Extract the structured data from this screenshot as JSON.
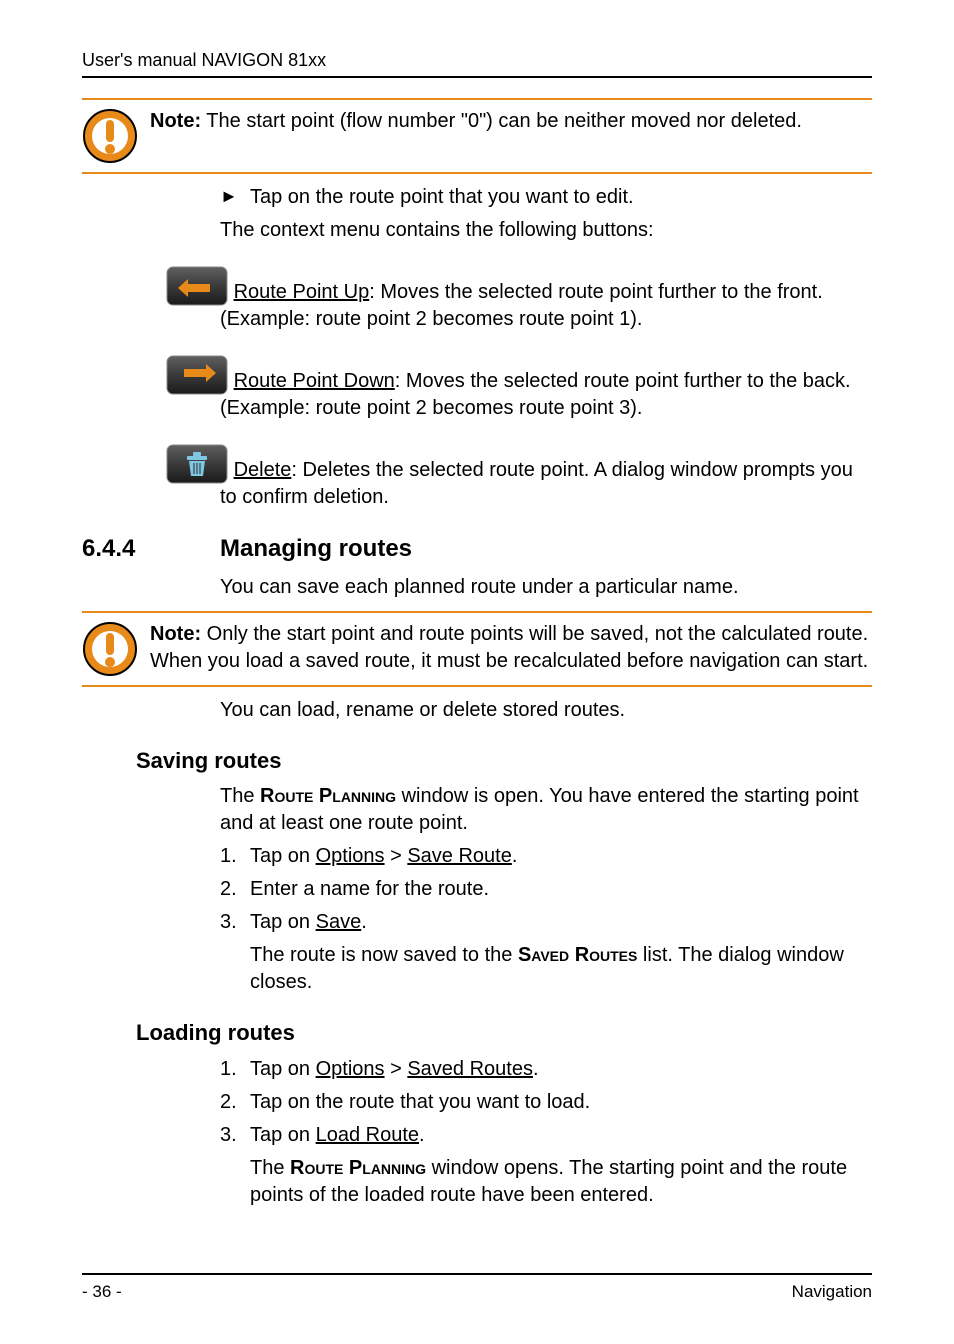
{
  "header": {
    "running_head": "User's manual NAVIGON 81xx"
  },
  "note1": {
    "label": "Note:",
    "text": " The start point (flow number \"0\") can be neither moved nor deleted."
  },
  "intro": {
    "bullet": "Tap on the route point that you want to edit.",
    "context_line": "The context menu contains the following buttons:"
  },
  "buttons": {
    "up_label": "Route Point Up",
    "up_text": ": Moves the selected route point further to the front. (Example: route point 2 becomes route point 1).",
    "down_label": "Route Point Down",
    "down_text": ": Moves the selected route point further to the back. (Example: route point 2 becomes route point 3).",
    "del_label": "Delete",
    "del_text": ": Deletes the selected route point. A dialog window prompts you to confirm deletion."
  },
  "section": {
    "number": "6.4.4",
    "title": "Managing routes",
    "intro": "You can save each planned route under a particular name."
  },
  "note2": {
    "label": "Note:",
    "text": " Only the start point and route points will be saved, not the calculated route. When you load a saved route, it must be recalculated before navigation can start."
  },
  "after_note2": "You can load, rename or delete stored routes.",
  "saving": {
    "title": "Saving routes",
    "intro_pre": "The ",
    "intro_sc1": "Route Planning",
    "intro_post": " window is open. You have entered the starting point and at least one route point.",
    "steps": {
      "s1_pre": "Tap on ",
      "s1_u1": "Options",
      "s1_mid": " > ",
      "s1_u2": "Save Route",
      "s1_post": ".",
      "s2": "Enter a name for the route.",
      "s3_pre": "Tap on ",
      "s3_u": "Save",
      "s3_post": ".",
      "s3_sub_pre": "The route is now saved to the ",
      "s3_sub_sc": "Saved Routes",
      "s3_sub_post": " list. The dialog window closes."
    }
  },
  "loading": {
    "title": "Loading routes",
    "steps": {
      "s1_pre": "Tap on ",
      "s1_u1": "Options",
      "s1_mid": " > ",
      "s1_u2": "Saved Routes",
      "s1_post": ".",
      "s2": "Tap on the route that you want to load.",
      "s3_pre": "Tap on ",
      "s3_u": "Load Route",
      "s3_post": ".",
      "s3_sub_pre": "The ",
      "s3_sub_sc": "Route Planning",
      "s3_sub_post": " window opens. The starting point and the route points of the loaded route have been entered."
    }
  },
  "footer": {
    "page": "- 36 -",
    "section": "Navigation"
  },
  "list_numbers": {
    "n1": "1.",
    "n2": "2.",
    "n3": "3."
  }
}
